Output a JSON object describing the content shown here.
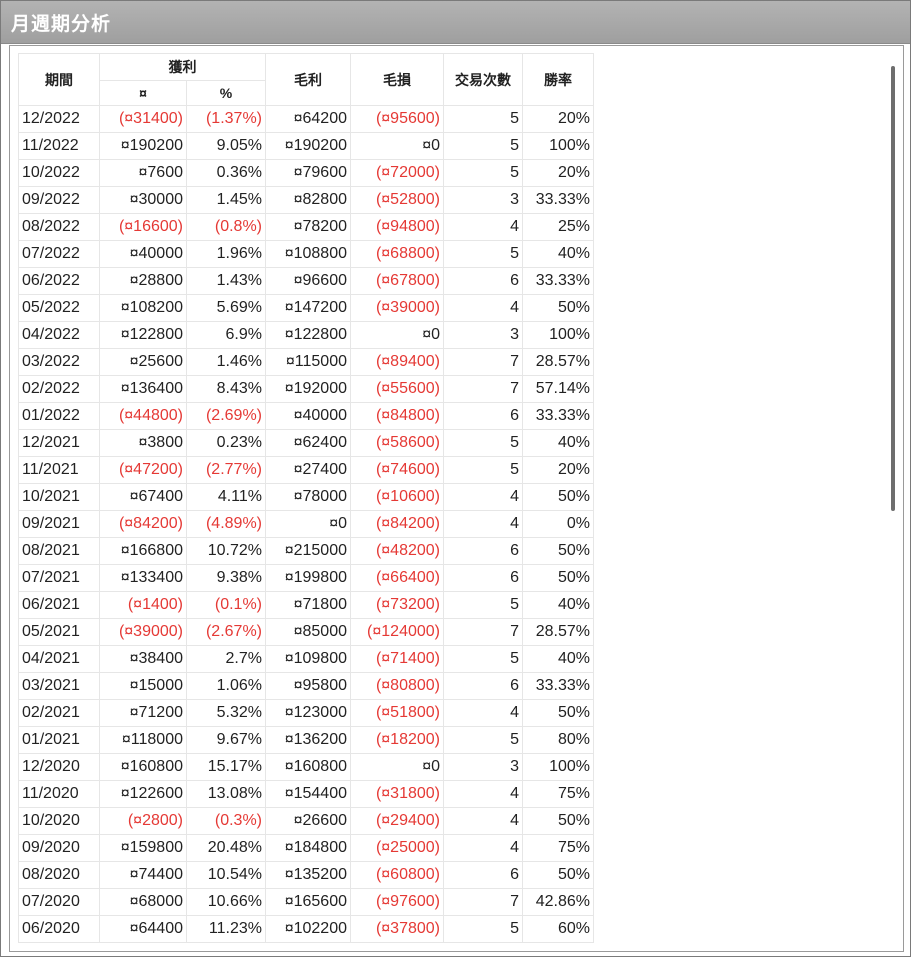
{
  "window": {
    "title": "月週期分析"
  },
  "table": {
    "headers": {
      "period": "期間",
      "profit_group": "獲利",
      "profit_amount": "¤",
      "profit_pct": "%",
      "gross_profit": "毛利",
      "gross_loss": "毛損",
      "trades": "交易次數",
      "win_rate": "勝率"
    },
    "rows": [
      {
        "period": "12/2022",
        "pnl": "(¤31400)",
        "pct": "(1.37%)",
        "gp": "¤64200",
        "gl": "(¤95600)",
        "cnt": "5",
        "win": "20%"
      },
      {
        "period": "11/2022",
        "pnl": "¤190200",
        "pct": "9.05%",
        "gp": "¤190200",
        "gl": "¤0",
        "cnt": "5",
        "win": "100%"
      },
      {
        "period": "10/2022",
        "pnl": "¤7600",
        "pct": "0.36%",
        "gp": "¤79600",
        "gl": "(¤72000)",
        "cnt": "5",
        "win": "20%"
      },
      {
        "period": "09/2022",
        "pnl": "¤30000",
        "pct": "1.45%",
        "gp": "¤82800",
        "gl": "(¤52800)",
        "cnt": "3",
        "win": "33.33%"
      },
      {
        "period": "08/2022",
        "pnl": "(¤16600)",
        "pct": "(0.8%)",
        "gp": "¤78200",
        "gl": "(¤94800)",
        "cnt": "4",
        "win": "25%"
      },
      {
        "period": "07/2022",
        "pnl": "¤40000",
        "pct": "1.96%",
        "gp": "¤108800",
        "gl": "(¤68800)",
        "cnt": "5",
        "win": "40%"
      },
      {
        "period": "06/2022",
        "pnl": "¤28800",
        "pct": "1.43%",
        "gp": "¤96600",
        "gl": "(¤67800)",
        "cnt": "6",
        "win": "33.33%"
      },
      {
        "period": "05/2022",
        "pnl": "¤108200",
        "pct": "5.69%",
        "gp": "¤147200",
        "gl": "(¤39000)",
        "cnt": "4",
        "win": "50%"
      },
      {
        "period": "04/2022",
        "pnl": "¤122800",
        "pct": "6.9%",
        "gp": "¤122800",
        "gl": "¤0",
        "cnt": "3",
        "win": "100%"
      },
      {
        "period": "03/2022",
        "pnl": "¤25600",
        "pct": "1.46%",
        "gp": "¤115000",
        "gl": "(¤89400)",
        "cnt": "7",
        "win": "28.57%"
      },
      {
        "period": "02/2022",
        "pnl": "¤136400",
        "pct": "8.43%",
        "gp": "¤192000",
        "gl": "(¤55600)",
        "cnt": "7",
        "win": "57.14%"
      },
      {
        "period": "01/2022",
        "pnl": "(¤44800)",
        "pct": "(2.69%)",
        "gp": "¤40000",
        "gl": "(¤84800)",
        "cnt": "6",
        "win": "33.33%"
      },
      {
        "period": "12/2021",
        "pnl": "¤3800",
        "pct": "0.23%",
        "gp": "¤62400",
        "gl": "(¤58600)",
        "cnt": "5",
        "win": "40%"
      },
      {
        "period": "11/2021",
        "pnl": "(¤47200)",
        "pct": "(2.77%)",
        "gp": "¤27400",
        "gl": "(¤74600)",
        "cnt": "5",
        "win": "20%"
      },
      {
        "period": "10/2021",
        "pnl": "¤67400",
        "pct": "4.11%",
        "gp": "¤78000",
        "gl": "(¤10600)",
        "cnt": "4",
        "win": "50%"
      },
      {
        "period": "09/2021",
        "pnl": "(¤84200)",
        "pct": "(4.89%)",
        "gp": "¤0",
        "gl": "(¤84200)",
        "cnt": "4",
        "win": "0%"
      },
      {
        "period": "08/2021",
        "pnl": "¤166800",
        "pct": "10.72%",
        "gp": "¤215000",
        "gl": "(¤48200)",
        "cnt": "6",
        "win": "50%"
      },
      {
        "period": "07/2021",
        "pnl": "¤133400",
        "pct": "9.38%",
        "gp": "¤199800",
        "gl": "(¤66400)",
        "cnt": "6",
        "win": "50%"
      },
      {
        "period": "06/2021",
        "pnl": "(¤1400)",
        "pct": "(0.1%)",
        "gp": "¤71800",
        "gl": "(¤73200)",
        "cnt": "5",
        "win": "40%"
      },
      {
        "period": "05/2021",
        "pnl": "(¤39000)",
        "pct": "(2.67%)",
        "gp": "¤85000",
        "gl": "(¤124000)",
        "cnt": "7",
        "win": "28.57%"
      },
      {
        "period": "04/2021",
        "pnl": "¤38400",
        "pct": "2.7%",
        "gp": "¤109800",
        "gl": "(¤71400)",
        "cnt": "5",
        "win": "40%"
      },
      {
        "period": "03/2021",
        "pnl": "¤15000",
        "pct": "1.06%",
        "gp": "¤95800",
        "gl": "(¤80800)",
        "cnt": "6",
        "win": "33.33%"
      },
      {
        "period": "02/2021",
        "pnl": "¤71200",
        "pct": "5.32%",
        "gp": "¤123000",
        "gl": "(¤51800)",
        "cnt": "4",
        "win": "50%"
      },
      {
        "period": "01/2021",
        "pnl": "¤118000",
        "pct": "9.67%",
        "gp": "¤136200",
        "gl": "(¤18200)",
        "cnt": "5",
        "win": "80%"
      },
      {
        "period": "12/2020",
        "pnl": "¤160800",
        "pct": "15.17%",
        "gp": "¤160800",
        "gl": "¤0",
        "cnt": "3",
        "win": "100%"
      },
      {
        "period": "11/2020",
        "pnl": "¤122600",
        "pct": "13.08%",
        "gp": "¤154400",
        "gl": "(¤31800)",
        "cnt": "4",
        "win": "75%"
      },
      {
        "period": "10/2020",
        "pnl": "(¤2800)",
        "pct": "(0.3%)",
        "gp": "¤26600",
        "gl": "(¤29400)",
        "cnt": "4",
        "win": "50%"
      },
      {
        "period": "09/2020",
        "pnl": "¤159800",
        "pct": "20.48%",
        "gp": "¤184800",
        "gl": "(¤25000)",
        "cnt": "4",
        "win": "75%"
      },
      {
        "period": "08/2020",
        "pnl": "¤74400",
        "pct": "10.54%",
        "gp": "¤135200",
        "gl": "(¤60800)",
        "cnt": "6",
        "win": "50%"
      },
      {
        "period": "07/2020",
        "pnl": "¤68000",
        "pct": "10.66%",
        "gp": "¤165600",
        "gl": "(¤97600)",
        "cnt": "7",
        "win": "42.86%"
      },
      {
        "period": "06/2020",
        "pnl": "¤64400",
        "pct": "11.23%",
        "gp": "¤102200",
        "gl": "(¤37800)",
        "cnt": "5",
        "win": "60%"
      }
    ]
  },
  "colors": {
    "negative": "#e53935",
    "titlebar": "#a8a8a8"
  }
}
